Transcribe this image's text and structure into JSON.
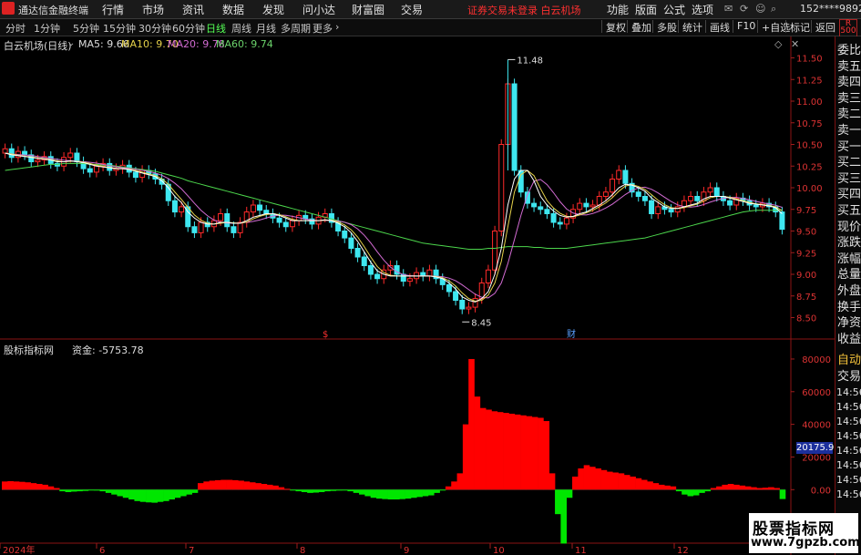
{
  "menu": {
    "app_name": "通达信金融终端",
    "items": [
      "行情",
      "市场",
      "资讯",
      "数据",
      "发现",
      "问小达",
      "财富圈",
      "交易"
    ],
    "notice": "证券交易未登录  白云机场",
    "right_items": [
      "功能",
      "版面",
      "公式",
      "选项"
    ],
    "user": "152****9892"
  },
  "periods": {
    "items": [
      "分时",
      "1分钟",
      "5分钟",
      "15分钟",
      "30分钟",
      "60分钟",
      "日线",
      "周线",
      "月线",
      "多周期",
      "更多"
    ],
    "active": "日线"
  },
  "toolbar": [
    "复权",
    "叠加",
    "多股",
    "统计",
    "画线",
    "F10",
    "+自选",
    "标记",
    "返回"
  ],
  "price_panel": {
    "title": "白云机场(日线)",
    "ma5": "MA5: 9.66",
    "ma10": "MA10: 9.70",
    "ma20": "MA20: 9.78",
    "ma60": "MA60: 9.74",
    "high_label": "11.48",
    "low_label": "8.45",
    "marker_s": "$",
    "marker_cai": "财"
  },
  "volume_panel": {
    "title": "股标指标网",
    "label": "资金: -5753.78",
    "balance_tag": "20175.91"
  },
  "side_column": {
    "tag": "R\n500",
    "rows": [
      "委比",
      "卖五",
      "卖四",
      "卖三",
      "卖二",
      "卖一",
      "买一",
      "买二",
      "买三",
      "买四",
      "买五",
      "现价",
      "涨跌",
      "涨幅",
      "总量",
      "外盘",
      "换手",
      "净资",
      "收益",
      "自动",
      "交易"
    ],
    "times": [
      "14:56",
      "14:56",
      "14:56",
      "14:56",
      "14:56",
      "14:56",
      "14:56",
      "14:56"
    ]
  },
  "watermark": {
    "line1": "股票指标网",
    "line2": "www.7gpzb.com"
  },
  "colors": {
    "up": "#ff2a2a",
    "down": "#3ee7f0",
    "ma5": "#ffffff",
    "ma10": "#e6d24a",
    "ma20": "#d36bd3",
    "ma60": "#4cd64c",
    "flow_up": "#ff0000",
    "flow_down": "#00e600"
  },
  "chart_data": [
    {
      "type": "candlestick",
      "title": "白云机场(日线)",
      "ylim": [
        8.4,
        11.6
      ],
      "y_ticks": [
        11.5,
        11.25,
        11.0,
        10.75,
        10.5,
        10.25,
        10.0,
        9.75,
        9.5,
        9.25,
        9.0,
        8.75,
        8.5
      ],
      "x_ticks": [
        "2024年",
        "6",
        "7",
        "8",
        "9",
        "10",
        "11",
        "12"
      ],
      "close": [
        10.45,
        10.35,
        10.42,
        10.38,
        10.3,
        10.32,
        10.36,
        10.28,
        10.25,
        10.35,
        10.4,
        10.3,
        10.22,
        10.18,
        10.25,
        10.28,
        10.2,
        10.22,
        10.26,
        10.18,
        10.12,
        10.2,
        10.16,
        10.1,
        10.04,
        9.85,
        9.72,
        9.78,
        9.55,
        9.48,
        9.6,
        9.55,
        9.62,
        9.7,
        9.55,
        9.48,
        9.6,
        9.72,
        9.8,
        9.74,
        9.7,
        9.65,
        9.6,
        9.55,
        9.62,
        9.68,
        9.64,
        9.58,
        9.66,
        9.7,
        9.6,
        9.5,
        9.42,
        9.3,
        9.2,
        9.1,
        9.0,
        8.95,
        9.05,
        9.1,
        9.0,
        8.92,
        8.95,
        9.02,
        8.98,
        9.05,
        8.95,
        8.88,
        8.8,
        8.7,
        8.6,
        8.62,
        8.72,
        8.9,
        9.05,
        9.5,
        10.5,
        11.2,
        10.2,
        9.95,
        9.82,
        9.78,
        9.75,
        9.7,
        9.6,
        9.58,
        9.65,
        9.75,
        9.82,
        9.78,
        9.8,
        9.9,
        9.95,
        10.1,
        10.2,
        10.05,
        9.95,
        9.9,
        9.85,
        9.7,
        9.78,
        9.75,
        9.72,
        9.78,
        9.85,
        9.9,
        9.85,
        9.95,
        10.0,
        9.9,
        9.85,
        9.8,
        9.88,
        9.85,
        9.8,
        9.78,
        9.82,
        9.78,
        9.72,
        9.52
      ],
      "ma5": [
        10.4,
        10.38,
        10.37,
        10.36,
        10.35,
        10.34,
        10.33,
        10.32,
        10.3,
        10.3,
        10.31,
        10.3,
        10.29,
        10.27,
        10.25,
        10.24,
        10.23,
        10.22,
        10.22,
        10.21,
        10.19,
        10.17,
        10.15,
        10.13,
        10.08,
        10.0,
        9.9,
        9.83,
        9.72,
        9.65,
        9.6,
        9.58,
        9.58,
        9.6,
        9.6,
        9.59,
        9.59,
        9.62,
        9.66,
        9.68,
        9.7,
        9.7,
        9.68,
        9.65,
        9.62,
        9.62,
        9.62,
        9.62,
        9.62,
        9.63,
        9.62,
        9.59,
        9.55,
        9.48,
        9.38,
        9.26,
        9.14,
        9.04,
        9.0,
        8.98,
        8.98,
        8.98,
        8.98,
        8.98,
        8.98,
        8.98,
        8.97,
        8.95,
        8.9,
        8.83,
        8.74,
        8.7,
        8.68,
        8.72,
        8.8,
        9.0,
        9.3,
        9.8,
        10.1,
        10.2,
        10.2,
        10.08,
        9.9,
        9.8,
        9.73,
        9.68,
        9.66,
        9.67,
        9.7,
        9.72,
        9.76,
        9.8,
        9.85,
        9.92,
        10.0,
        10.04,
        10.03,
        10.0,
        9.96,
        9.88,
        9.83,
        9.78,
        9.76,
        9.76,
        9.78,
        9.8,
        9.82,
        9.87,
        9.9,
        9.9,
        9.9,
        9.88,
        9.86,
        9.84,
        9.82,
        9.81,
        9.8,
        9.79,
        9.77,
        9.7
      ],
      "ma60": [
        10.2,
        10.21,
        10.22,
        10.23,
        10.24,
        10.25,
        10.26,
        10.27,
        10.27,
        10.28,
        10.28,
        10.28,
        10.28,
        10.27,
        10.27,
        10.26,
        10.26,
        10.25,
        10.24,
        10.23,
        10.22,
        10.21,
        10.2,
        10.19,
        10.17,
        10.15,
        10.13,
        10.11,
        10.08,
        10.06,
        10.04,
        10.02,
        10.0,
        9.98,
        9.96,
        9.94,
        9.92,
        9.9,
        9.88,
        9.86,
        9.84,
        9.82,
        9.8,
        9.78,
        9.76,
        9.74,
        9.72,
        9.7,
        9.68,
        9.66,
        9.64,
        9.62,
        9.6,
        9.58,
        9.56,
        9.54,
        9.52,
        9.5,
        9.48,
        9.46,
        9.44,
        9.42,
        9.4,
        9.38,
        9.36,
        9.35,
        9.34,
        9.33,
        9.32,
        9.31,
        9.3,
        9.29,
        9.29,
        9.29,
        9.3,
        9.3,
        9.31,
        9.32,
        9.32,
        9.32,
        9.32,
        9.31,
        9.31,
        9.3,
        9.3,
        9.3,
        9.3,
        9.31,
        9.32,
        9.33,
        9.34,
        9.35,
        9.36,
        9.37,
        9.38,
        9.39,
        9.4,
        9.41,
        9.42,
        9.44,
        9.46,
        9.48,
        9.5,
        9.52,
        9.54,
        9.56,
        9.58,
        9.6,
        9.62,
        9.64,
        9.66,
        9.68,
        9.7,
        9.72,
        9.73,
        9.74,
        9.74,
        9.74,
        9.74,
        9.74
      ]
    },
    {
      "type": "bar",
      "title": "资金",
      "ylim": [
        -35000,
        85000
      ],
      "y_ticks": [
        80000,
        60000,
        40000,
        20000,
        0
      ],
      "values": [
        5000,
        5200,
        5000,
        4800,
        4500,
        4000,
        3500,
        3000,
        2000,
        1000,
        -1000,
        -1500,
        -1200,
        -1000,
        -800,
        -500,
        -600,
        -1000,
        -2000,
        -3000,
        -4000,
        -5000,
        -6000,
        -7000,
        -7500,
        -7800,
        -8000,
        -7500,
        -7000,
        -6000,
        -5000,
        -4000,
        -3000,
        -2000,
        4000,
        5000,
        5500,
        5800,
        6000,
        6000,
        5800,
        5500,
        5000,
        4500,
        4000,
        3500,
        3000,
        2500,
        1500,
        500,
        -500,
        -1000,
        -1500,
        -2000,
        -1800,
        -1500,
        -1000,
        -800,
        -600,
        -500,
        -1000,
        -2000,
        -3000,
        -4000,
        -5000,
        -5500,
        -5800,
        -6000,
        -6000,
        -5800,
        -5500,
        -5000,
        -4500,
        -4000,
        -3500,
        -2000,
        -500,
        2000,
        5000,
        10000,
        40000,
        80000,
        57000,
        50000,
        49000,
        48000,
        47500,
        47000,
        46500,
        46000,
        45500,
        45000,
        44500,
        44000,
        42000,
        10000,
        -15000,
        -33000,
        -5000,
        8000,
        13000,
        15000,
        14000,
        13000,
        12000,
        11000,
        10500,
        10000,
        9000,
        8000,
        7000,
        6000,
        5000,
        4000,
        3000,
        2500,
        2000,
        -1000,
        -3000,
        -4000,
        -3500,
        -2000,
        -1000,
        1000,
        2000,
        3000,
        3500,
        3000,
        2500,
        2000,
        1500,
        1000,
        1200,
        1500,
        1000,
        -5753.78
      ]
    }
  ]
}
